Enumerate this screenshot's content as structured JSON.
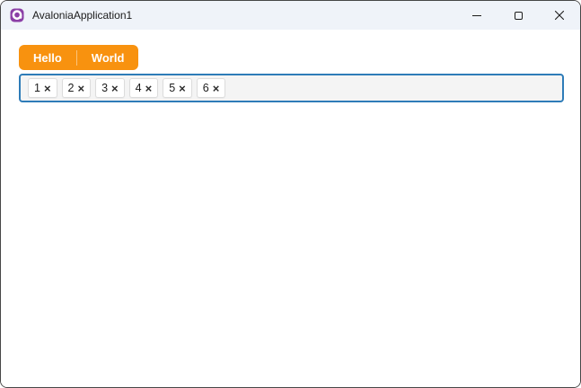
{
  "window": {
    "title": "AvaloniaApplication1"
  },
  "titlebar": {
    "icon": "avalonia-logo"
  },
  "tabstrip": {
    "tabs": [
      {
        "label": "Hello"
      },
      {
        "label": "World"
      }
    ]
  },
  "tag_input": {
    "chips": [
      {
        "label": "1"
      },
      {
        "label": "2"
      },
      {
        "label": "3"
      },
      {
        "label": "4"
      },
      {
        "label": "5"
      },
      {
        "label": "6"
      }
    ],
    "remove_glyph": "×"
  },
  "icons": {
    "app_logo": "avalonia-logo",
    "minimize": "horizontal-line",
    "maximize": "outline-square",
    "close": "x-cross",
    "chip_remove": "×"
  },
  "colors": {
    "titlebar_bg": "#EFF3F9",
    "window_border": "#474747",
    "tab_orange": "#F8920F",
    "tab_text": "#FFFFFF",
    "focus_border": "#2E7CB8",
    "input_bg": "#F4F4F4",
    "chip_bg": "#FFFFFF",
    "chip_border": "#DCDCDC",
    "content_bg": "#FFFFFF"
  }
}
